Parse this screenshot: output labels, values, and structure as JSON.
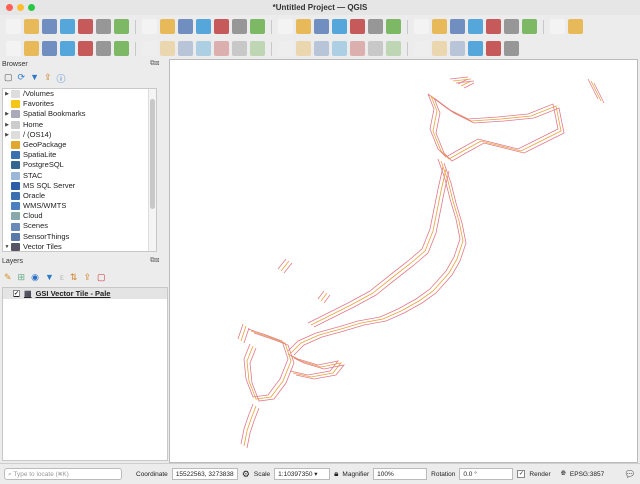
{
  "window": {
    "title": "*Untitled Project — QGIS"
  },
  "toolbar1": [
    "new-project",
    "open-project",
    "save-project",
    "save-as",
    "print-layout",
    "style-manager",
    "pan",
    "pan-to-selection",
    "zoom-in",
    "zoom-out",
    "zoom-full",
    "zoom-to-selection",
    "zoom-to-layer",
    "zoom-native",
    "zoom-last",
    "zoom-next",
    "new-map-view",
    "new-3d-view",
    "new-bookmark",
    "show-bookmarks",
    "temporal-controller",
    "refresh",
    "select-features",
    "deselect",
    "select-by-value",
    "select-location",
    "identify",
    "attribute-table",
    "processing-toolbox",
    "statistics"
  ],
  "toolbar2": [
    "data-source-manager",
    "new-geopackage-layer",
    "new-shapefile",
    "new-spatialite",
    "new-virtual-layer",
    "new-temp-scratch",
    "new-mesh",
    "digitize",
    "toggle-editing",
    "save-edits",
    "add-feature",
    "vertex-tool",
    "delete-selected",
    "cut",
    "copy",
    "paste",
    "undo",
    "redo",
    "label-tool",
    "pin-labels",
    "show-labels",
    "highlight-labels",
    "move-label",
    "rotate-label",
    "quickosm",
    "python-console",
    "help"
  ],
  "browser": {
    "title": "Browser",
    "items": [
      {
        "label": "/Volumes",
        "expand": true,
        "icon": "folder-icon",
        "color": "#ddd"
      },
      {
        "label": "Favorites",
        "expand": false,
        "icon": "star-icon",
        "color": "#f5c518"
      },
      {
        "label": "Spatial Bookmarks",
        "expand": true,
        "icon": "bookmark-icon",
        "color": "#aab"
      },
      {
        "label": "Home",
        "expand": true,
        "icon": "home-icon",
        "color": "#ccc"
      },
      {
        "label": "/ (OS14)",
        "expand": true,
        "icon": "folder-icon",
        "color": "#ddd"
      },
      {
        "label": "GeoPackage",
        "expand": false,
        "icon": "geopackage-icon",
        "color": "#e0a82e"
      },
      {
        "label": "SpatiaLite",
        "expand": false,
        "icon": "spatialite-icon",
        "color": "#3a6fb0"
      },
      {
        "label": "PostgreSQL",
        "expand": false,
        "icon": "postgresql-icon",
        "color": "#336791"
      },
      {
        "label": "STAC",
        "expand": false,
        "icon": "stac-icon",
        "color": "#9bb8d8"
      },
      {
        "label": "MS SQL Server",
        "expand": false,
        "icon": "mssql-icon",
        "color": "#2a5ea8"
      },
      {
        "label": "Oracle",
        "expand": false,
        "icon": "oracle-icon",
        "color": "#3a6fb0"
      },
      {
        "label": "WMS/WMTS",
        "expand": false,
        "icon": "wms-icon",
        "color": "#4a80c0"
      },
      {
        "label": "Cloud",
        "expand": false,
        "icon": "cloud-icon",
        "color": "#8aa"
      },
      {
        "label": "Scenes",
        "expand": false,
        "icon": "scenes-icon",
        "color": "#6a8ab8"
      },
      {
        "label": "SensorThings",
        "expand": false,
        "icon": "sensorthings-icon",
        "color": "#5a7aa8"
      },
      {
        "label": "Vector Tiles",
        "expand": "open",
        "icon": "vector-tiles-icon",
        "color": "#556"
      }
    ]
  },
  "layers": {
    "title": "Layers",
    "items": [
      {
        "label": "GSI Vector Tile - Pale",
        "checked": true
      }
    ]
  },
  "status": {
    "locate_placeholder": "Type to locate (⌘K)",
    "coordinate_label": "Coordinate",
    "coordinate": "15522563, 3273838",
    "scale_label": "Scale",
    "scale": "1:10397350",
    "magnifier_label": "Magnifier",
    "magnifier": "100%",
    "rotation_label": "Rotation",
    "rotation": "0.0 °",
    "render_label": "Render",
    "render": true,
    "crs": "EPSG:3857"
  },
  "colors": {
    "map_line_a": "#e8a23a",
    "map_line_b": "#e07a8a"
  }
}
